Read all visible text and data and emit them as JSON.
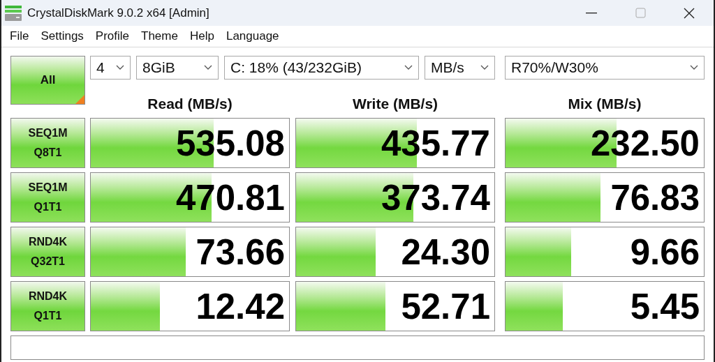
{
  "window": {
    "title": "CrystalDiskMark 9.0.2 x64 [Admin]"
  },
  "menu": [
    "File",
    "Settings",
    "Profile",
    "Theme",
    "Help",
    "Language"
  ],
  "all_button": {
    "label": "All"
  },
  "dropdowns": [
    {
      "value": "4"
    },
    {
      "value": "8GiB"
    },
    {
      "value": "C: 18% (43/232GiB)"
    },
    {
      "value": "MB/s"
    },
    {
      "value": "R70%/W30%"
    }
  ],
  "columns": [
    "Read (MB/s)",
    "Write (MB/s)",
    "Mix (MB/s)"
  ],
  "tests": [
    {
      "label": [
        "SEQ1M",
        "Q8T1"
      ],
      "results": [
        {
          "value": "535.08",
          "level": 0.62
        },
        {
          "value": "435.77",
          "level": 0.61
        },
        {
          "value": "232.50",
          "level": 0.56
        }
      ]
    },
    {
      "label": [
        "SEQ1M",
        "Q1T1"
      ],
      "results": [
        {
          "value": "470.81",
          "level": 0.61
        },
        {
          "value": "373.74",
          "level": 0.59
        },
        {
          "value": "76.83",
          "level": 0.48
        }
      ]
    },
    {
      "label": [
        "RND4K",
        "Q32T1"
      ],
      "results": [
        {
          "value": "73.66",
          "level": 0.48
        },
        {
          "value": "24.30",
          "level": 0.4
        },
        {
          "value": "9.66",
          "level": 0.33
        }
      ]
    },
    {
      "label": [
        "RND4K",
        "Q1T1"
      ],
      "results": [
        {
          "value": "12.42",
          "level": 0.35
        },
        {
          "value": "52.71",
          "level": 0.45
        },
        {
          "value": "5.45",
          "level": 0.29
        }
      ]
    }
  ]
}
